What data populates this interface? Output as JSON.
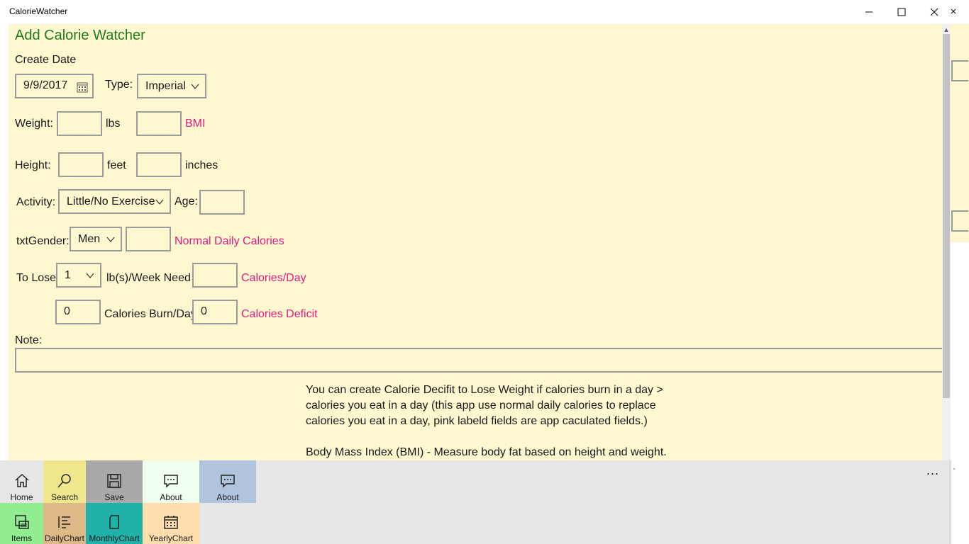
{
  "window": {
    "title": "CalorieWatcher"
  },
  "page": {
    "heading": "Add Calorie Watcher",
    "create_date_label": "Create Date",
    "create_date_value": "9/9/2017",
    "type_label": "Type:",
    "type_value": "Imperial",
    "weight_label": "Weight:",
    "weight_unit": "lbs",
    "bmi_label": "BMI",
    "height_label": "Height:",
    "feet_label": "feet",
    "inches_label": "inches",
    "activity_label": "Activity:",
    "activity_value": "Little/No Exercise",
    "age_label": "Age:",
    "gender_label": "txtGender:",
    "gender_value": "Men",
    "normal_daily_calories_label": "Normal Daily Calories",
    "to_lose_label": "To Lose",
    "to_lose_value": "1",
    "per_week_need_label": "lb(s)/Week Need",
    "calories_per_day_label": "Calories/Day",
    "calories_burn_value": "0",
    "calories_burn_label": "Calories Burn/Day",
    "calories_deficit_value": "0",
    "calories_deficit_label": "Calories Deficit",
    "note_label": "Note:",
    "info_line1": "You can create Calorie Decifit to Lose Weight if calories burn in a day >",
    "info_line2": "calories you eat in a day (this app use normal daily calories to replace",
    "info_line3": "calories you eat in a day, pink labeld fields are app caculated fields.)",
    "info_line4": "Body Mass Index (BMI) - Measure body fat based on height and weight."
  },
  "commands": {
    "row1": [
      {
        "label": "Home",
        "icon": "home-icon",
        "color": "#e6e6e6"
      },
      {
        "label": "Search",
        "icon": "search-icon",
        "color": "#f0e68c"
      },
      {
        "label": "Save",
        "icon": "save-icon",
        "color": "#a9a9a9"
      },
      {
        "label": "About",
        "icon": "message-icon",
        "color": "#f0fff0"
      },
      {
        "label": "About",
        "icon": "message-icon",
        "color": "#b0c4de"
      }
    ],
    "row2": [
      {
        "label": "Items",
        "icon": "items-icon",
        "color": "#90ee90"
      },
      {
        "label": "DailyChart",
        "icon": "list-icon",
        "color": "#deb887"
      },
      {
        "label": "MonthlyChart",
        "icon": "page-icon",
        "color": "#20b2aa"
      },
      {
        "label": "YearlyChart",
        "icon": "calendar-icon",
        "color": "#ffdead"
      }
    ],
    "more": "...",
    "more2": "·"
  }
}
